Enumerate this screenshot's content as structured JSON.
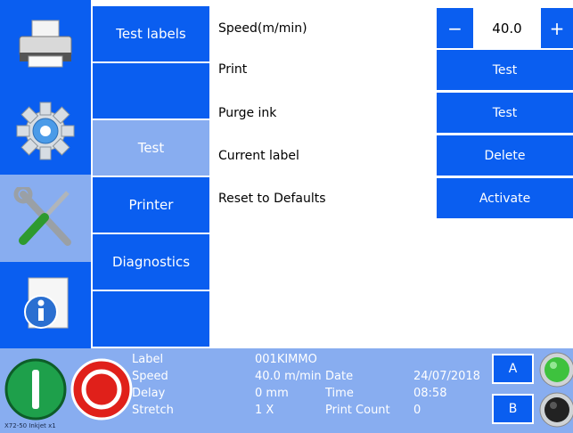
{
  "nav_icons": [
    {
      "name": "printer-icon"
    },
    {
      "name": "gear-icon"
    },
    {
      "name": "tools-icon"
    },
    {
      "name": "info-icon"
    }
  ],
  "menu": {
    "test_labels": "Test labels",
    "blank1": "",
    "test": "Test",
    "printer": "Printer",
    "diagnostics": "Diagnostics",
    "blank2": ""
  },
  "settings": {
    "speed_label": "Speed(m/min)",
    "speed_value": "40.0",
    "minus": "−",
    "plus": "+",
    "print_label": "Print",
    "print_btn": "Test",
    "purge_label": "Purge ink",
    "purge_btn": "Test",
    "current_label": "Current label",
    "current_btn": "Delete",
    "reset_label": "Reset to Defaults",
    "reset_btn": "Activate"
  },
  "status": {
    "label_key": "Label",
    "label_val": "001KIMMO",
    "speed_key": "Speed",
    "speed_val": "40.0 m/min",
    "delay_key": "Delay",
    "delay_val": "0 mm",
    "stretch_key": "Stretch",
    "stretch_val": "1 X",
    "date_key": "Date",
    "date_val": "24/07/2018",
    "time_key": "Time",
    "time_val": "08:58",
    "count_key": "Print Count",
    "count_val": "0",
    "btn_a": "A",
    "btn_b": "B",
    "footer": "X72-50 Inkjet x1"
  },
  "colors": {
    "primary": "#0a5ef0",
    "selected": "#88adf0",
    "start_green": "#1ea04b",
    "stop_red": "#e0201a",
    "lamp_green": "#3ec23e",
    "lamp_off": "#222222"
  }
}
